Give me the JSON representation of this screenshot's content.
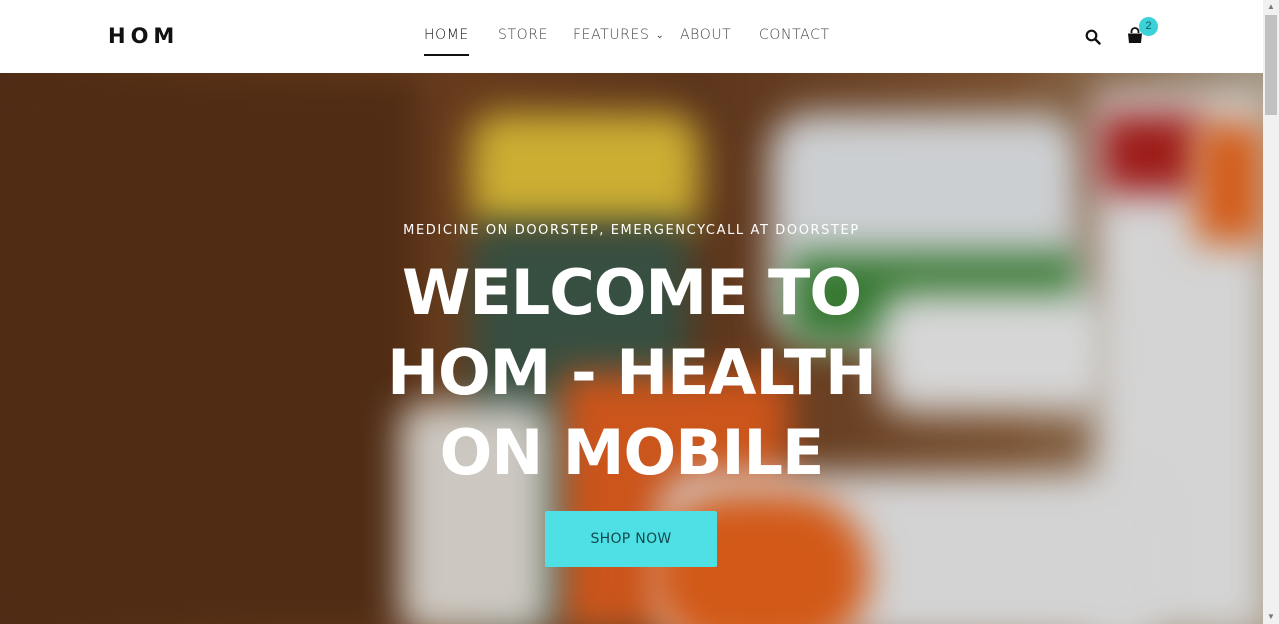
{
  "header": {
    "logo": "HOM",
    "nav": [
      {
        "label": "HOME",
        "active": true
      },
      {
        "label": "STORE"
      },
      {
        "label": "FEATURES",
        "dropdown": true
      },
      {
        "label": "ABOUT"
      },
      {
        "label": "CONTACT"
      }
    ],
    "cart_count": "2",
    "icons": [
      "search-icon",
      "shopping-bag-icon"
    ]
  },
  "hero": {
    "subtitle": "MEDICINE ON DOORSTEP, EMERGENCYCALL AT DOORSTEP",
    "title": "WELCOME TO HOM - HEALTH ON MOBILE",
    "cta_label": "SHOP NOW"
  },
  "colors": {
    "accent": "#4fe0e6",
    "badge": "#3ad2d8",
    "text_dark": "#111111"
  }
}
